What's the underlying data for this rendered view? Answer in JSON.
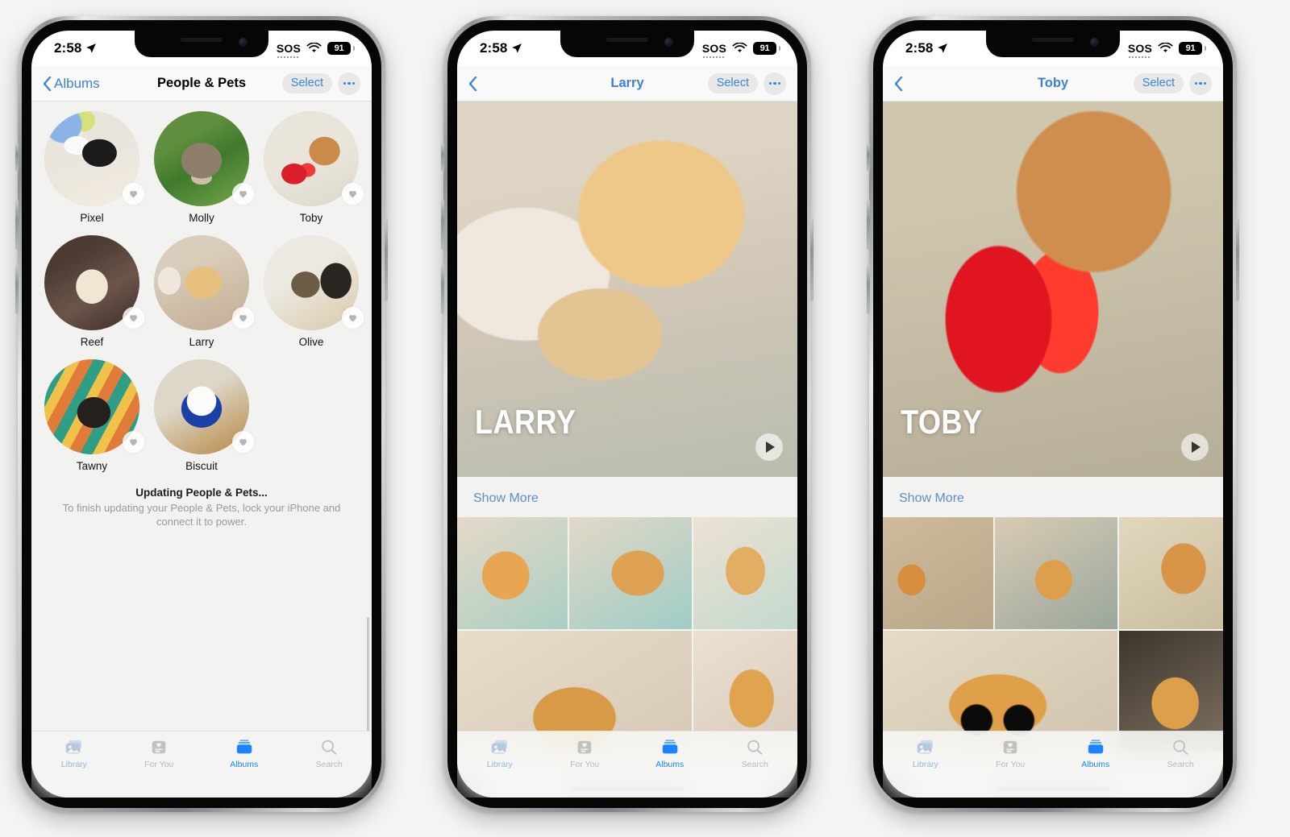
{
  "status_bar": {
    "time": "2:58",
    "sos_label": "SOS",
    "battery": "91",
    "location_icon": "location-arrow-icon",
    "wifi_icon": "wifi-icon"
  },
  "tab_bar": {
    "tabs": [
      {
        "label": "Library",
        "icon": "photo-stack-icon",
        "state": "semi"
      },
      {
        "label": "For You",
        "icon": "for-you-card-icon",
        "state": "dim"
      },
      {
        "label": "Albums",
        "icon": "albums-stack-icon",
        "state": "active"
      },
      {
        "label": "Search",
        "icon": "magnifier-icon",
        "state": "dim"
      }
    ]
  },
  "colors": {
    "accent_blue": "#1a84ff",
    "link_blue": "#3b82d6",
    "show_more_blue": "#5d90c4",
    "screen_bg": "#f2f2f0",
    "heart_gray": "#b6b6b6"
  },
  "phone1": {
    "nav": {
      "back_label": "Albums",
      "title": "People & Pets",
      "select_label": "Select",
      "more_icon": "ellipsis-icon"
    },
    "pets": [
      {
        "name": "Pixel",
        "art": "a-pixel",
        "favorite_icon": "heart-icon"
      },
      {
        "name": "Molly",
        "art": "a-molly",
        "favorite_icon": "heart-icon"
      },
      {
        "name": "Toby",
        "art": "a-toby",
        "favorite_icon": "heart-icon"
      },
      {
        "name": "Reef",
        "art": "a-reef",
        "favorite_icon": "heart-icon"
      },
      {
        "name": "Larry",
        "art": "a-larry",
        "favorite_icon": "heart-icon"
      },
      {
        "name": "Olive",
        "art": "a-olive",
        "favorite_icon": "heart-icon"
      },
      {
        "name": "Tawny",
        "art": "a-tawny",
        "favorite_icon": "heart-icon"
      },
      {
        "name": "Biscuit",
        "art": "a-biscuit",
        "favorite_icon": "heart-icon"
      }
    ],
    "updating": {
      "title": "Updating People & Pets...",
      "subtitle": "To finish updating your People & Pets, lock your iPhone and connect it to power."
    }
  },
  "phone2": {
    "nav": {
      "back_label": "",
      "title": "Larry",
      "select_label": "Select",
      "more_icon": "ellipsis-icon"
    },
    "hero": {
      "overlay_title": "LARRY",
      "art": "a-hero-larry",
      "play_icon": "play-icon"
    },
    "show_more_label": "Show More",
    "photos": [
      {
        "art": "a-g1",
        "size": "small"
      },
      {
        "art": "a-g2",
        "size": "small"
      },
      {
        "art": "a-g3",
        "size": "small"
      },
      {
        "art": "a-g4",
        "size": "wide"
      },
      {
        "art": "a-g5",
        "size": "tall"
      }
    ]
  },
  "phone3": {
    "nav": {
      "back_label": "",
      "title": "Toby",
      "select_label": "Select",
      "more_icon": "ellipsis-icon"
    },
    "hero": {
      "overlay_title": "TOBY",
      "art": "a-hero-toby",
      "play_icon": "play-icon"
    },
    "show_more_label": "Show More",
    "photos": [
      {
        "art": "a-h1",
        "size": "small"
      },
      {
        "art": "a-h2",
        "size": "small"
      },
      {
        "art": "a-h3",
        "size": "small"
      },
      {
        "art": "a-h4",
        "size": "wide"
      },
      {
        "art": "a-h5",
        "size": "tall"
      }
    ]
  }
}
